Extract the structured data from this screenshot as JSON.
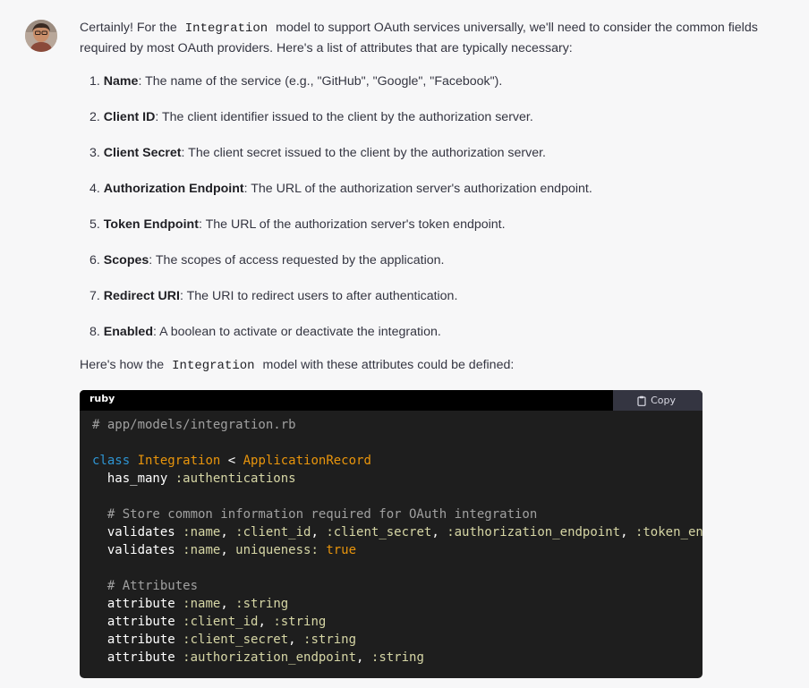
{
  "intro": {
    "part1": "Certainly! For the",
    "code": "Integration",
    "part2": "model to support OAuth services universally, we'll need to consider the common fields required by most OAuth providers. Here's a list of attributes that are typically necessary:"
  },
  "attributes": [
    {
      "number": "1.",
      "term": "Name",
      "desc": ": The name of the service (e.g., \"GitHub\", \"Google\", \"Facebook\")."
    },
    {
      "number": "2.",
      "term": "Client ID",
      "desc": ": The client identifier issued to the client by the authorization server."
    },
    {
      "number": "3.",
      "term": "Client Secret",
      "desc": ": The client secret issued to the client by the authorization server."
    },
    {
      "number": "4.",
      "term": "Authorization Endpoint",
      "desc": ": The URL of the authorization server's authorization endpoint."
    },
    {
      "number": "5.",
      "term": "Token Endpoint",
      "desc": ": The URL of the authorization server's token endpoint."
    },
    {
      "number": "6.",
      "term": "Scopes",
      "desc": ": The scopes of access requested by the application."
    },
    {
      "number": "7.",
      "term": "Redirect URI",
      "desc": ": The URI to redirect users to after authentication."
    },
    {
      "number": "8.",
      "term": "Enabled",
      "desc": ": A boolean to activate or deactivate the integration."
    }
  ],
  "outro": {
    "part1": "Here's how the",
    "code": "Integration",
    "part2": "model with these attributes could be defined:"
  },
  "codeblock": {
    "language": "ruby",
    "copy_label": "Copy",
    "lines": [
      [
        {
          "t": "# app/models/integration.rb",
          "k": "comment"
        }
      ],
      [],
      [
        {
          "t": "class",
          "k": "keyword"
        },
        {
          "t": " ",
          "k": "plain"
        },
        {
          "t": "Integration",
          "k": "class"
        },
        {
          "t": " < ",
          "k": "plain"
        },
        {
          "t": "ApplicationRecord",
          "k": "class"
        }
      ],
      [
        {
          "t": "  has_many ",
          "k": "plain"
        },
        {
          "t": ":authentications",
          "k": "sym"
        }
      ],
      [],
      [
        {
          "t": "  # Store common information required for OAuth integration",
          "k": "comment"
        }
      ],
      [
        {
          "t": "  validates ",
          "k": "plain"
        },
        {
          "t": ":name",
          "k": "sym"
        },
        {
          "t": ", ",
          "k": "plain"
        },
        {
          "t": ":client_id",
          "k": "sym"
        },
        {
          "t": ", ",
          "k": "plain"
        },
        {
          "t": ":client_secret",
          "k": "sym"
        },
        {
          "t": ", ",
          "k": "plain"
        },
        {
          "t": ":authorization_endpoint",
          "k": "sym"
        },
        {
          "t": ", ",
          "k": "plain"
        },
        {
          "t": ":token_en",
          "k": "sym"
        }
      ],
      [
        {
          "t": "  validates ",
          "k": "plain"
        },
        {
          "t": ":name",
          "k": "sym"
        },
        {
          "t": ", ",
          "k": "plain"
        },
        {
          "t": "uniqueness:",
          "k": "sym"
        },
        {
          "t": " ",
          "k": "plain"
        },
        {
          "t": "true",
          "k": "bool"
        }
      ],
      [],
      [
        {
          "t": "  # Attributes",
          "k": "comment"
        }
      ],
      [
        {
          "t": "  attribute ",
          "k": "plain"
        },
        {
          "t": ":name",
          "k": "sym"
        },
        {
          "t": ", ",
          "k": "plain"
        },
        {
          "t": ":string",
          "k": "sym"
        }
      ],
      [
        {
          "t": "  attribute ",
          "k": "plain"
        },
        {
          "t": ":client_id",
          "k": "sym"
        },
        {
          "t": ", ",
          "k": "plain"
        },
        {
          "t": ":string",
          "k": "sym"
        }
      ],
      [
        {
          "t": "  attribute ",
          "k": "plain"
        },
        {
          "t": ":client_secret",
          "k": "sym"
        },
        {
          "t": ", ",
          "k": "plain"
        },
        {
          "t": ":string",
          "k": "sym"
        }
      ],
      [
        {
          "t": "  attribute ",
          "k": "plain"
        },
        {
          "t": ":authorization_endpoint",
          "k": "sym"
        },
        {
          "t": ", ",
          "k": "plain"
        },
        {
          "t": ":string",
          "k": "sym"
        }
      ]
    ]
  },
  "icons": {
    "avatar": "user-avatar",
    "copy": "clipboard-icon"
  },
  "colors": {
    "page_background": "#f7f7f8",
    "code_background": "#1e1e1e",
    "comment": "#a0a0a0",
    "keyword": "#2e95d3",
    "class_name": "#e9950c",
    "symbol": "#d6d6a5"
  }
}
